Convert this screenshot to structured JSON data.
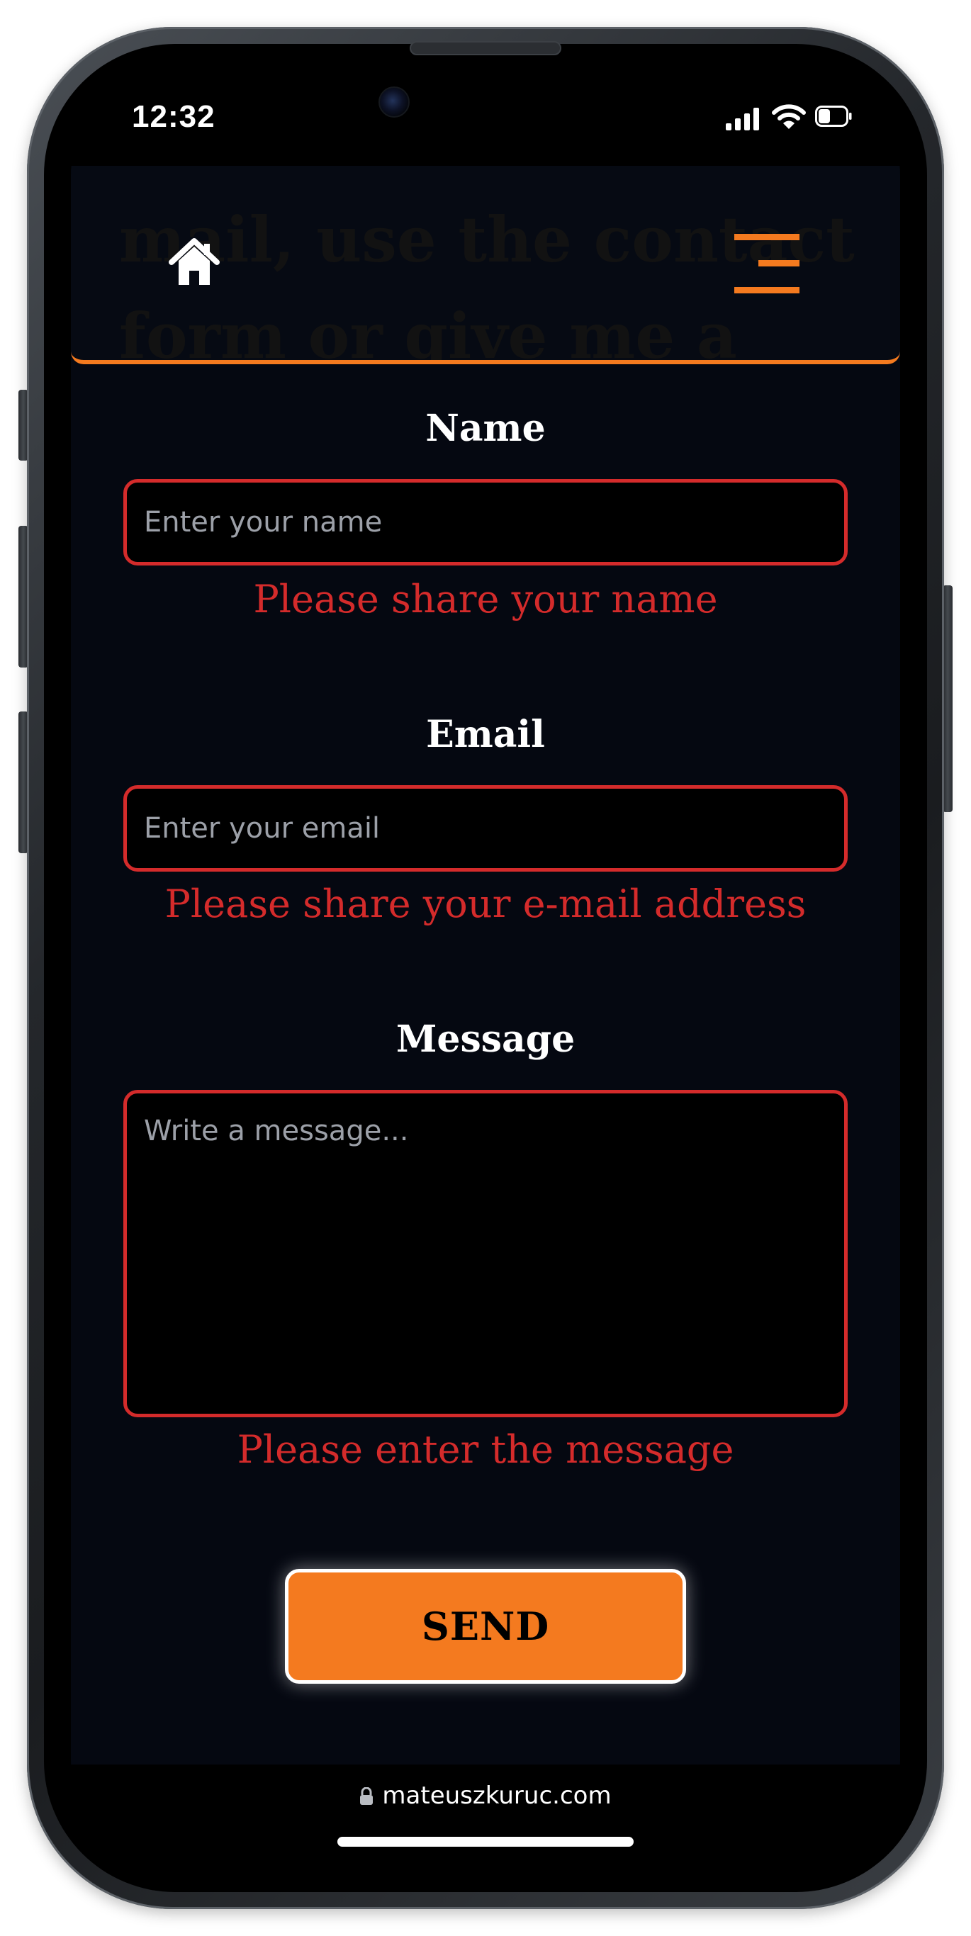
{
  "status_bar": {
    "time": "12:32",
    "icons": [
      "signal-icon",
      "wifi-icon",
      "battery-icon"
    ]
  },
  "header": {
    "background_text": "mail, use the contact\nform or give me a call.",
    "home_icon": "home-icon",
    "menu_icon": "hamburger-menu-icon",
    "accent_color": "#f47a1f"
  },
  "form": {
    "name": {
      "label": "Name",
      "placeholder": "Enter your name",
      "value": "",
      "error": "Please share your name"
    },
    "email": {
      "label": "Email",
      "placeholder": "Enter your email",
      "value": "",
      "error": "Please share your e-mail address"
    },
    "message": {
      "label": "Message",
      "placeholder": "Write a message...",
      "value": "",
      "error": "Please enter the message"
    },
    "send_label": "SEND",
    "error_color": "#d42b2b"
  },
  "browser": {
    "url": "mateuszkuruc.com",
    "lock_icon": "lock-icon"
  }
}
